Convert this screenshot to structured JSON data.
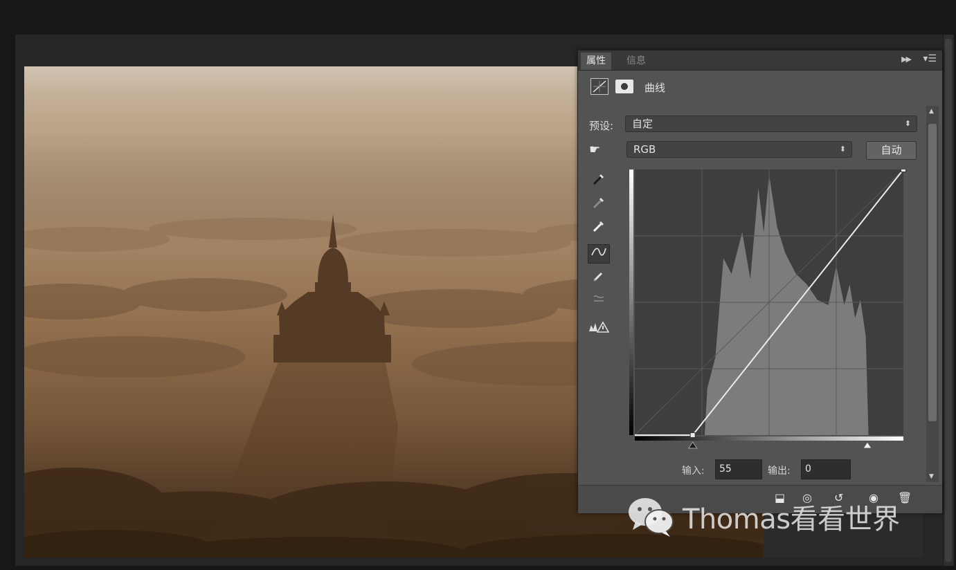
{
  "panel": {
    "tabs": [
      {
        "label": "属性",
        "active": true
      },
      {
        "label": "信息",
        "active": false
      }
    ],
    "collapse_icon": "double-arrow-right-icon",
    "menu_icon": "panel-menu-icon",
    "header": {
      "icons": [
        "curves-adjustment-icon",
        "layer-mask-icon"
      ],
      "title": "曲线"
    },
    "preset": {
      "label": "预设:",
      "value": "自定"
    },
    "channel": {
      "value": "RGB"
    },
    "auto_button": "自动",
    "tools": [
      "on-image-adjust-hand-icon",
      "black-point-eyedropper-icon",
      "gray-point-eyedropper-icon",
      "white-point-eyedropper-icon",
      "curve-edit-points-icon",
      "pencil-draw-icon",
      "smooth-curve-icon",
      "clipping-warning-icon"
    ],
    "curve": {
      "points": [
        [
          55,
          0
        ],
        [
          255,
          255
        ]
      ],
      "black_slider": 55,
      "white_slider": 255
    },
    "input": {
      "label": "输入:",
      "value": "55"
    },
    "output": {
      "label": "输出:",
      "value": "0"
    },
    "footer_icons": [
      "clip-to-layer-icon",
      "view-previous-state-icon",
      "reset-icon",
      "visibility-eye-icon",
      "trash-icon"
    ]
  },
  "watermark": {
    "text": "Thomas看看世界",
    "icon": "wechat-logo-icon"
  },
  "colors": {
    "panel_bg": "#535353",
    "graph_bg": "#3e3e3e",
    "histogram": "#7c7c7c",
    "curve": "#ececec"
  }
}
